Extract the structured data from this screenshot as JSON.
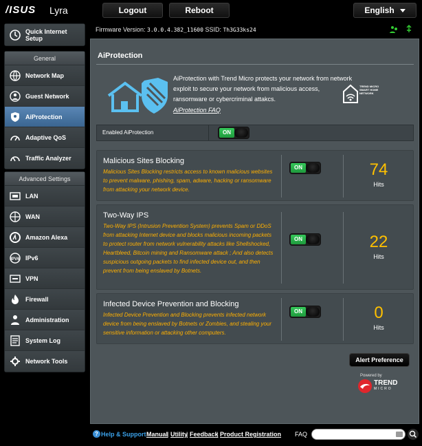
{
  "brand": {
    "logo": "/ISUS",
    "model": "Lyra"
  },
  "top": {
    "logout": "Logout",
    "reboot": "Reboot",
    "language": "English"
  },
  "sidebar": {
    "qis_label": "Quick Internet Setup",
    "general_header": "General",
    "general_items": [
      {
        "label": "Network Map",
        "icon": "network-map-icon"
      },
      {
        "label": "Guest Network",
        "icon": "guest-network-icon"
      },
      {
        "label": "AiProtection",
        "icon": "aiprotection-icon",
        "active": true
      },
      {
        "label": "Adaptive QoS",
        "icon": "qos-icon"
      },
      {
        "label": "Traffic Analyzer",
        "icon": "traffic-analyzer-icon"
      }
    ],
    "advanced_header": "Advanced Settings",
    "advanced_items": [
      {
        "label": "LAN",
        "icon": "lan-icon"
      },
      {
        "label": "WAN",
        "icon": "wan-icon"
      },
      {
        "label": "Amazon Alexa",
        "icon": "alexa-icon"
      },
      {
        "label": "IPv6",
        "icon": "ipv6-icon"
      },
      {
        "label": "VPN",
        "icon": "vpn-icon"
      },
      {
        "label": "Firewall",
        "icon": "firewall-icon"
      },
      {
        "label": "Administration",
        "icon": "administration-icon"
      },
      {
        "label": "System Log",
        "icon": "system-log-icon"
      },
      {
        "label": "Network Tools",
        "icon": "network-tools-icon"
      }
    ]
  },
  "status": {
    "firmware_label": "Firmware Version:",
    "firmware_value": "3.0.0.4.382_11600",
    "ssid_label": "SSID:",
    "ssid_value": "Th3G33ks24"
  },
  "panel": {
    "title": "AiProtection",
    "intro": "AiProtection with Trend Micro protects your network from network exploit to secure your network from malicious access, ransomware or cybercriminal attakcs.",
    "faq": "AiProtection FAQ",
    "tm_logo_text": "TREND MICRO SMART HOME NETWORK",
    "enable_label": "Enabled AiProtection",
    "enable_state": "ON"
  },
  "features": [
    {
      "title": "Malicious Sites Blocking",
      "desc": "Malicious Sites Blocking restricts access to known malicious websites to prevent malware, phishing, spam, adware, hacking or ransomware from attacking your network device.",
      "state": "ON",
      "hits": "74",
      "hits_label": "Hits"
    },
    {
      "title": "Two-Way IPS",
      "desc": "Two-Way IPS (Intrusion Prevention System) prevents Spam or DDoS from attacking Internet device and blocks malicious incoming packets to protect router from network vulnerability attacks like Shellshocked, Heartbleed, Bitcoin mining and Ransomware attack ; And also detects suspicious outgoing packets to find infected device out, and then prevent from being enslaved by Botnets.",
      "state": "ON",
      "hits": "22",
      "hits_label": "Hits"
    },
    {
      "title": "Infected Device Prevention and Blocking",
      "desc": "Infected Device Prevention and Blocking prevents infected network device from being enslaved by Botnets or Zombies, and stealing your sensitive information or attacking other computers.",
      "state": "ON",
      "hits": "0",
      "hits_label": "Hits"
    }
  ],
  "alert_pref": "Alert Preference",
  "powered_by": "Powered by",
  "trend_word": "TREND",
  "trend_sub": "MICRO",
  "footer": {
    "help": "Help & Support",
    "manual": "Manual",
    "utility": "Utility",
    "feedback": "Feedback",
    "product_reg": "Product Registration",
    "faq": "FAQ"
  },
  "colors": {
    "accent_hits": "#ffc000",
    "desc_text": "#ffb000",
    "toggle_on": "#34c759",
    "active_nav": "#4a78a8"
  }
}
